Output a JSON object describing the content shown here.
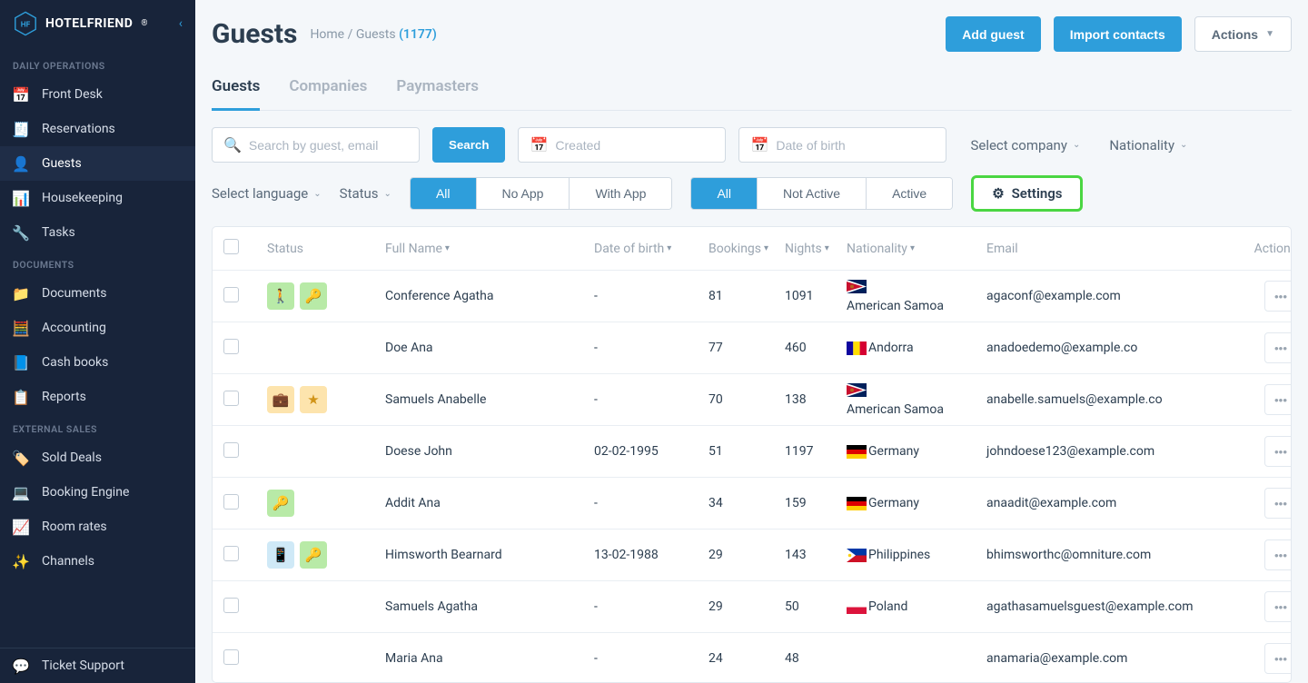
{
  "brand": "HOTELFRIEND",
  "sidebar": {
    "sections": [
      {
        "label": "DAILY OPERATIONS",
        "items": [
          {
            "label": "Front Desk",
            "icon": "📅"
          },
          {
            "label": "Reservations",
            "icon": "🧾"
          },
          {
            "label": "Guests",
            "icon": "👤",
            "active": true
          },
          {
            "label": "Housekeeping",
            "icon": "📊"
          },
          {
            "label": "Tasks",
            "icon": "🔧"
          }
        ]
      },
      {
        "label": "DOCUMENTS",
        "items": [
          {
            "label": "Documents",
            "icon": "📁"
          },
          {
            "label": "Accounting",
            "icon": "🧮"
          },
          {
            "label": "Cash books",
            "icon": "📘"
          },
          {
            "label": "Reports",
            "icon": "📋"
          }
        ]
      },
      {
        "label": "EXTERNAL SALES",
        "items": [
          {
            "label": "Sold Deals",
            "icon": "🏷️"
          },
          {
            "label": "Booking Engine",
            "icon": "💻"
          },
          {
            "label": "Room rates",
            "icon": "📈"
          },
          {
            "label": "Channels",
            "icon": "✨"
          }
        ]
      }
    ],
    "footer": {
      "label": "Ticket Support",
      "icon": "💬"
    }
  },
  "header": {
    "title": "Guests",
    "breadcrumb_home": "Home",
    "breadcrumb_section": "Guests",
    "count": "(1177)",
    "add_guest": "Add guest",
    "import": "Import contacts",
    "actions": "Actions"
  },
  "tabs": [
    {
      "label": "Guests",
      "active": true
    },
    {
      "label": "Companies"
    },
    {
      "label": "Paymasters"
    }
  ],
  "filters": {
    "search_placeholder": "Search by guest, email",
    "search_btn": "Search",
    "created_placeholder": "Created",
    "dob_placeholder": "Date of birth",
    "select_company": "Select company",
    "nationality": "Nationality",
    "select_language": "Select language",
    "status": "Status",
    "app_seg": [
      "All",
      "No App",
      "With App"
    ],
    "active_seg": [
      "All",
      "Not Active",
      "Active"
    ],
    "settings": "Settings"
  },
  "table": {
    "headers": {
      "status": "Status",
      "full_name": "Full Name",
      "dob": "Date of birth",
      "bookings": "Bookings",
      "nights": "Nights",
      "nationality": "Nationality",
      "email": "Email",
      "actions": "Actions"
    },
    "rows": [
      {
        "status": [
          "walk",
          "key"
        ],
        "name": "Conference Agatha",
        "dob": "-",
        "bookings": "81",
        "nights": "1091",
        "nat": "American Samoa",
        "flag": "as",
        "email": "agaconf@example.com"
      },
      {
        "status": [],
        "name": "Doe Ana",
        "dob": "-",
        "bookings": "77",
        "nights": "460",
        "nat": "Andorra",
        "flag": "ad",
        "email": "anadoedemo@example.co"
      },
      {
        "status": [
          "bag",
          "star"
        ],
        "name": "Samuels Anabelle",
        "dob": "-",
        "bookings": "70",
        "nights": "138",
        "nat": "American Samoa",
        "flag": "as",
        "email": "anabelle.samuels@example.co"
      },
      {
        "status": [],
        "name": "Doese John",
        "dob": "02-02-1995",
        "bookings": "51",
        "nights": "1197",
        "nat": "Germany",
        "flag": "de",
        "email": "johndoese123@example.com"
      },
      {
        "status": [
          "key"
        ],
        "name": "Addit Ana",
        "dob": "-",
        "bookings": "34",
        "nights": "159",
        "nat": "Germany",
        "flag": "de",
        "email": "anaadit@example.com"
      },
      {
        "status": [
          "phone",
          "key"
        ],
        "name": "Himsworth Bearnard",
        "dob": "13-02-1988",
        "bookings": "29",
        "nights": "143",
        "nat": "Philippines",
        "flag": "ph",
        "email": "bhimsworthc@omniture.com"
      },
      {
        "status": [],
        "name": "Samuels Agatha",
        "dob": "-",
        "bookings": "29",
        "nights": "50",
        "nat": "Poland",
        "flag": "pl",
        "email": "agathasamuelsguest@example.com"
      },
      {
        "status": [],
        "name": "Maria Ana",
        "dob": "-",
        "bookings": "24",
        "nights": "48",
        "nat": "",
        "flag": "",
        "email": "anamaria@example.com"
      }
    ]
  }
}
